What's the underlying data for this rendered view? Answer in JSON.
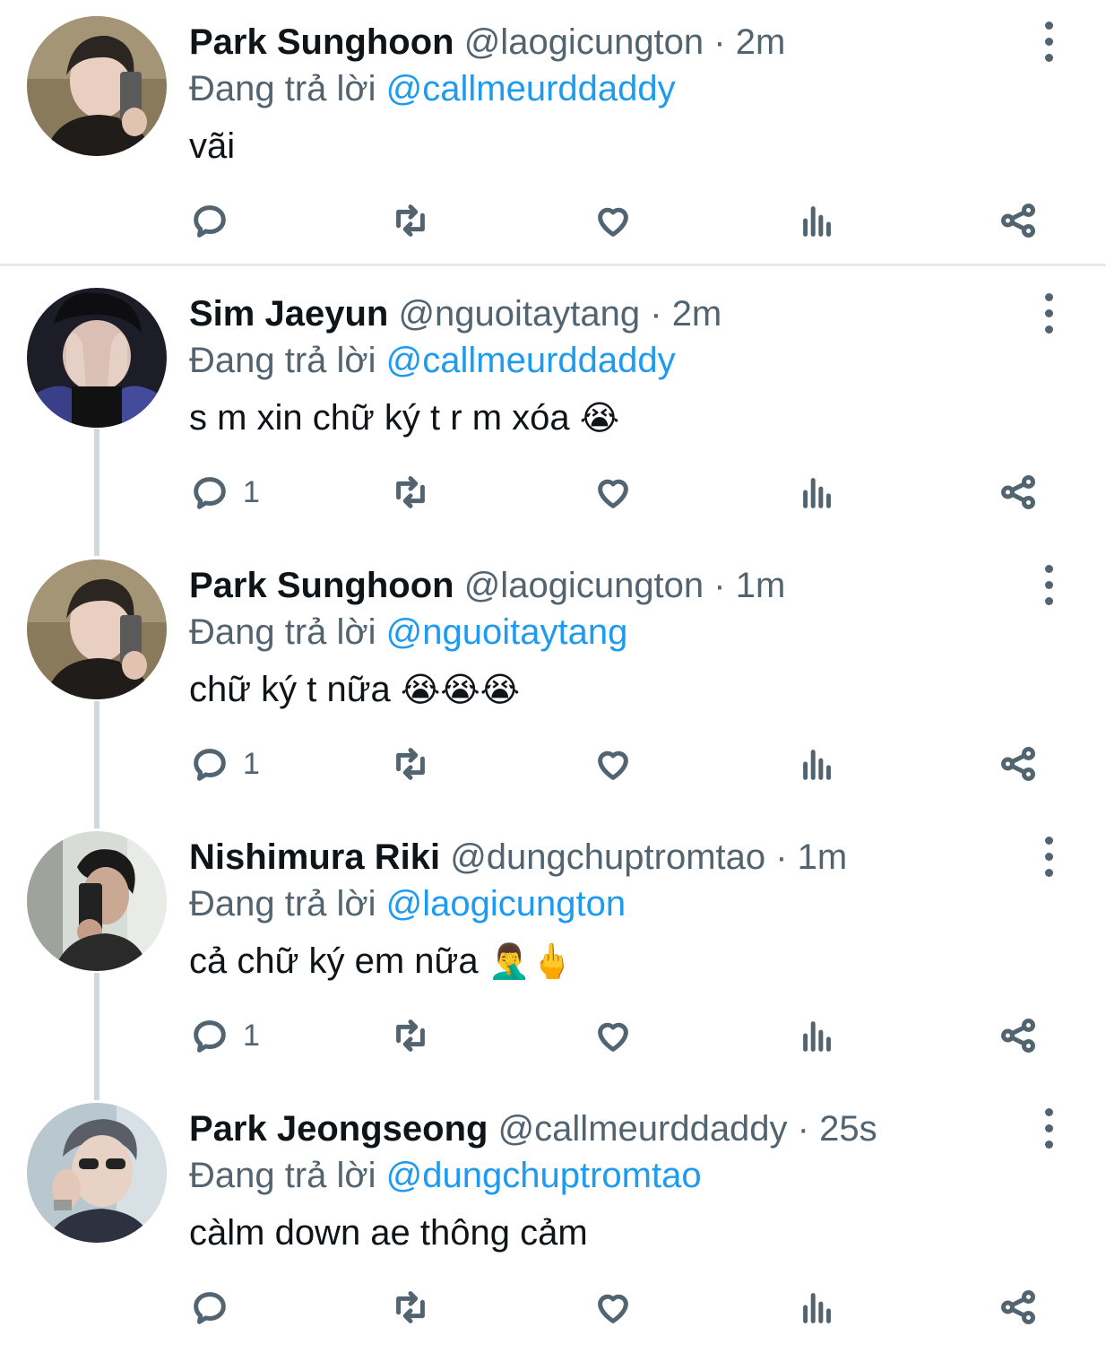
{
  "labels": {
    "replying_prefix": "Đang trả lời"
  },
  "tweets": [
    {
      "display_name": "Park Sunghoon",
      "meta": "@laogicungton · 2m",
      "reply_to": "@callmeurddaddy",
      "text": "vãi",
      "emoji": "",
      "reply_count": "",
      "avatar_icon": "avatar-photo"
    },
    {
      "display_name": "Sim Jaeyun",
      "meta": "@nguoitaytang · 2m",
      "reply_to": "@callmeurddaddy",
      "text": "s m xin chữ ký t r m xóa",
      "emoji": "😭",
      "reply_count": "1",
      "avatar_icon": "avatar-photo"
    },
    {
      "display_name": "Park Sunghoon",
      "meta": "@laogicungton · 1m",
      "reply_to": "@nguoitaytang",
      "text": "chữ ký t nữa",
      "emoji": "😭😭😭",
      "reply_count": "1",
      "avatar_icon": "avatar-photo"
    },
    {
      "display_name": "Nishimura Riki",
      "meta": "@dungchuptromtao · 1m",
      "reply_to": "@laogicungton",
      "text": "cả chữ ký em nữa",
      "emoji": "🤦‍♂️🖕",
      "reply_count": "1",
      "avatar_icon": "avatar-photo"
    },
    {
      "display_name": "Park Jeongseong",
      "meta": "@callmeurddaddy · 25s",
      "reply_to": "@dungchuptromtao",
      "text": "càlm down ae thông cảm",
      "emoji": "",
      "reply_count": "",
      "avatar_icon": "avatar-photo"
    }
  ],
  "icons": {
    "reply": "reply-icon",
    "retweet": "retweet-icon",
    "like": "heart-icon",
    "views": "analytics-icon",
    "share": "share-icon",
    "more": "more-vertical-icon"
  },
  "colors": {
    "mention": "#1d9bf0",
    "secondary_text": "#536471",
    "divider": "#e6e9eb",
    "thread_line": "#cfd9de"
  }
}
